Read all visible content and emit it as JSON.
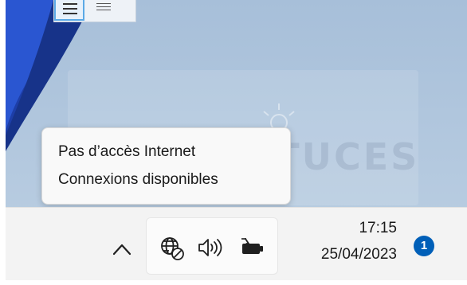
{
  "tooltip": {
    "line1": "Pas d’accès Internet",
    "line2": "Connexions disponibles"
  },
  "watermark": {
    "text": "PC ASTUCES"
  },
  "taskbar": {
    "tray": {
      "overflow_icon": "chevron-up-icon",
      "network_icon": "globe-no-internet-icon",
      "volume_icon": "speaker-icon",
      "battery_icon": "battery-charging-icon"
    },
    "clock": {
      "time": "17:15",
      "date": "25/04/2023"
    },
    "notification_count": "1"
  },
  "colors": {
    "badge": "#005fb8",
    "taskbar": "#f3f3f3",
    "wallpaper": "#a7bfd9",
    "wallpaper_shape": "#1d3ea8"
  }
}
